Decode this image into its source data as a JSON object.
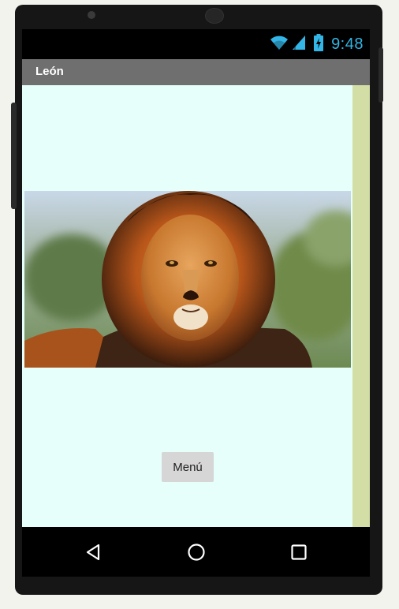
{
  "status_bar": {
    "time": "9:48",
    "icons": [
      "wifi-icon",
      "signal-icon",
      "battery-charging-icon"
    ],
    "accent_color": "#33b5e5"
  },
  "app": {
    "title": "León",
    "title_bar_color": "#6f6f6f",
    "background_color": "#e6fffb"
  },
  "main": {
    "image_icon": "lion-photo",
    "menu_button_label": "Menú"
  },
  "navigation_bar": {
    "back_icon": "back-triangle-icon",
    "home_icon": "home-circle-icon",
    "recents_icon": "recents-square-icon"
  }
}
